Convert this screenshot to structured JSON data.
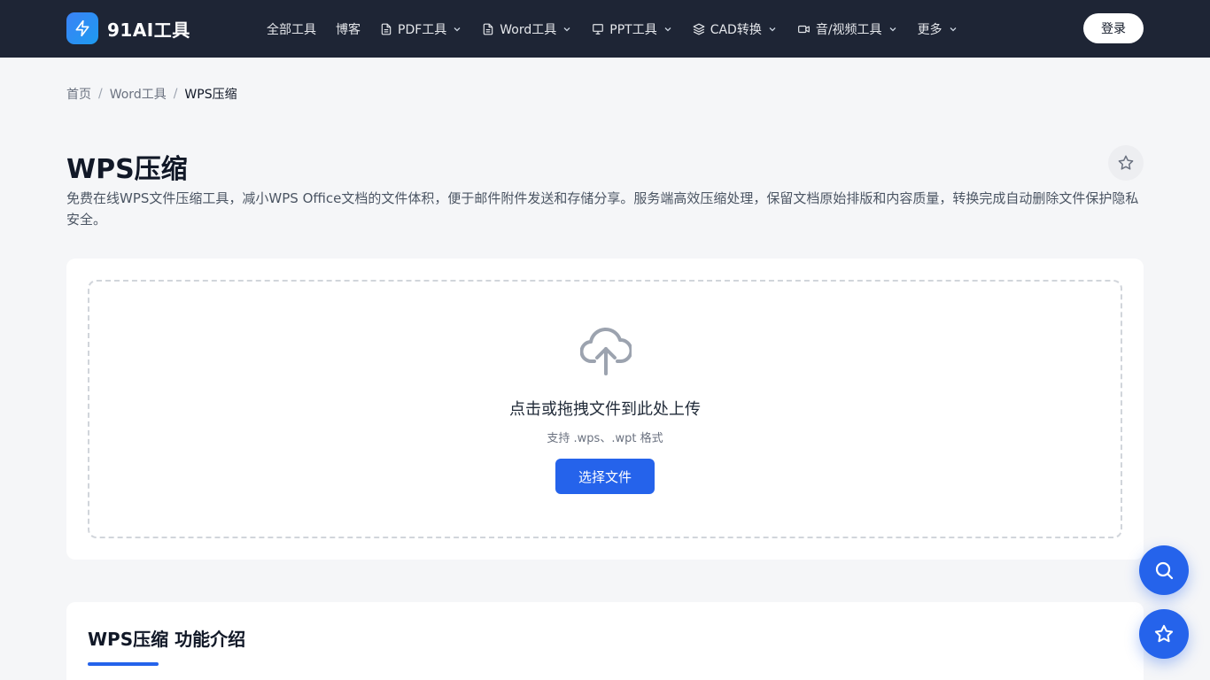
{
  "header": {
    "logo_text": "91AI工具",
    "nav": [
      {
        "label": "全部工具",
        "icon": "",
        "dropdown": false
      },
      {
        "label": "博客",
        "icon": "",
        "dropdown": false
      },
      {
        "label": "PDF工具",
        "icon": "file-icon",
        "dropdown": true
      },
      {
        "label": "Word工具",
        "icon": "file-icon",
        "dropdown": true
      },
      {
        "label": "PPT工具",
        "icon": "presentation-icon",
        "dropdown": true
      },
      {
        "label": "CAD转换",
        "icon": "layers-icon",
        "dropdown": true
      },
      {
        "label": "音/视频工具",
        "icon": "video-icon",
        "dropdown": true
      },
      {
        "label": "更多",
        "icon": "",
        "dropdown": true
      }
    ],
    "login_label": "登录"
  },
  "breadcrumb": {
    "home": "首页",
    "category": "Word工具",
    "current": "WPS压缩",
    "separator": "/"
  },
  "page": {
    "title": "WPS压缩",
    "description": "免费在线WPS文件压缩工具，减小WPS Office文档的文件体积，便于邮件附件发送和存储分享。服务端高效压缩处理，保留文档原始排版和内容质量，转换完成自动删除文件保护隐私安全。"
  },
  "upload": {
    "title": "点击或拖拽文件到此处上传",
    "hint": "支持 .wps、.wpt 格式",
    "button_label": "选择文件"
  },
  "feature": {
    "title": "WPS压缩 功能介绍"
  },
  "colors": {
    "header_bg": "#1e2535",
    "accent": "#2563eb",
    "page_bg": "#f5f6f8"
  }
}
